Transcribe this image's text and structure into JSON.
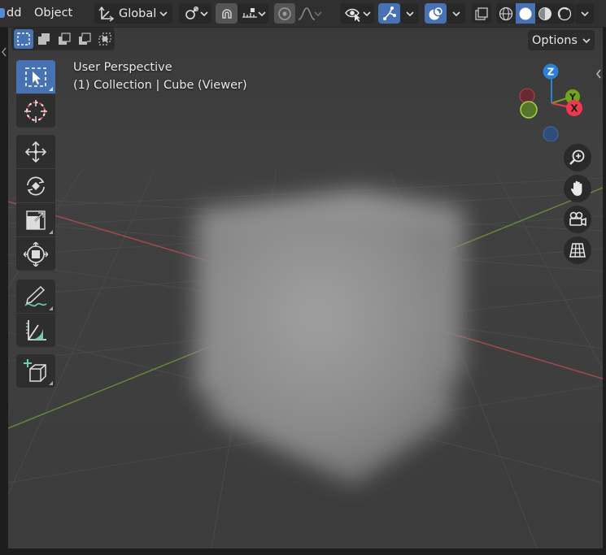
{
  "header": {
    "menu_partial": "dd",
    "menu_object": "Object",
    "orientation_label": "Global"
  },
  "viewport": {
    "view_name": "User Perspective",
    "collection_info": "(1) Collection | Cube (Viewer)",
    "options_label": "Options"
  },
  "gizmo": {
    "z_label": "Z",
    "y_label": "Y",
    "x_label": "X"
  },
  "colors": {
    "accent": "#4772b3",
    "x_axis": "#ee3a4c",
    "y_axis": "#71a41b",
    "z_axis": "#2c7ed6"
  },
  "icons": {
    "toolbar": [
      "select-box-icon",
      "cursor-icon",
      "move-icon",
      "rotate-icon",
      "scale-icon",
      "transform-icon",
      "annotate-icon",
      "measure-icon",
      "add-cube-icon"
    ],
    "navigation": [
      "zoom-icon",
      "pan-hand-icon",
      "camera-icon",
      "grid-ortho-icon"
    ]
  }
}
